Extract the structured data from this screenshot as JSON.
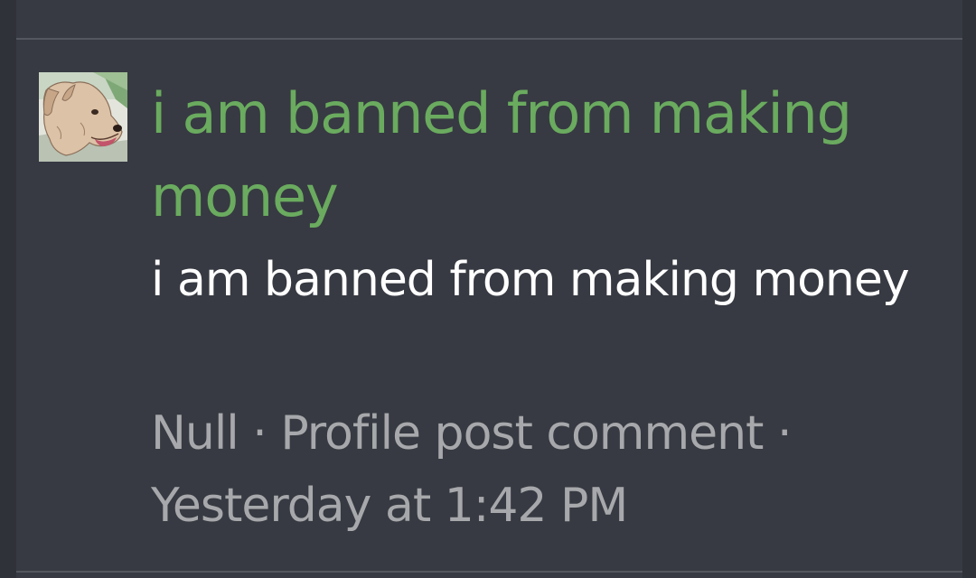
{
  "post": {
    "title": "i am banned from making money",
    "body": "i am banned from making money",
    "author": "Null",
    "separator": "·",
    "type": "Profile post comment",
    "timestamp": "Yesterday at 1:42 PM",
    "avatar_icon": "dog-avatar-icon"
  },
  "colors": {
    "background": "#303239",
    "panel": "#373A42",
    "title": "#6AAB5F",
    "body": "#FFFFFF",
    "meta": "#A7A8AB"
  }
}
